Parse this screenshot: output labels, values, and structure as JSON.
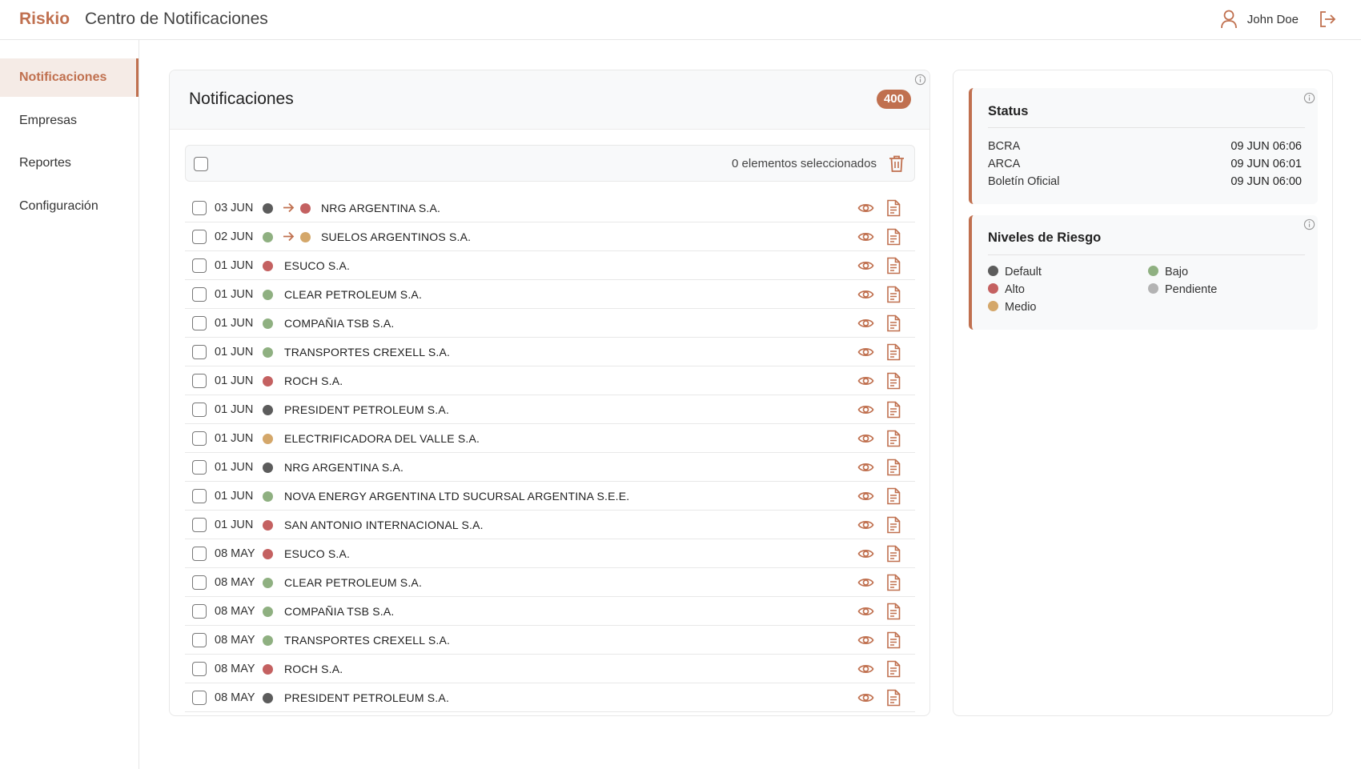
{
  "app": {
    "brand": "Riskio",
    "title": "Centro de Notificaciones",
    "user_name": "John Doe"
  },
  "sidebar": {
    "items": [
      {
        "label": "Notificaciones",
        "active": true
      },
      {
        "label": "Empresas",
        "active": false
      },
      {
        "label": "Reportes",
        "active": false
      },
      {
        "label": "Configuración",
        "active": false
      }
    ]
  },
  "notifications": {
    "title": "Notificaciones",
    "count": "400",
    "selected_text": "0 elementos seleccionados",
    "rows": [
      {
        "date": "03 JUN",
        "from": "default",
        "to": "alto",
        "company": "NRG ARGENTINA S.A."
      },
      {
        "date": "02 JUN",
        "from": "bajo",
        "to": "medio",
        "company": "SUELOS ARGENTINOS S.A."
      },
      {
        "date": "01 JUN",
        "level": "alto",
        "company": "ESUCO S.A."
      },
      {
        "date": "01 JUN",
        "level": "bajo",
        "company": "CLEAR PETROLEUM S.A."
      },
      {
        "date": "01 JUN",
        "level": "bajo",
        "company": "COMPAÑIA TSB S.A."
      },
      {
        "date": "01 JUN",
        "level": "bajo",
        "company": "TRANSPORTES CREXELL S.A."
      },
      {
        "date": "01 JUN",
        "level": "alto",
        "company": "ROCH S.A."
      },
      {
        "date": "01 JUN",
        "level": "default",
        "company": "PRESIDENT PETROLEUM S.A."
      },
      {
        "date": "01 JUN",
        "level": "medio",
        "company": "ELECTRIFICADORA DEL VALLE S.A."
      },
      {
        "date": "01 JUN",
        "level": "default",
        "company": "NRG ARGENTINA S.A."
      },
      {
        "date": "01 JUN",
        "level": "bajo",
        "company": "NOVA ENERGY ARGENTINA LTD SUCURSAL ARGENTINA S.E.E."
      },
      {
        "date": "01 JUN",
        "level": "alto",
        "company": "SAN ANTONIO INTERNACIONAL S.A."
      },
      {
        "date": "08 MAY",
        "level": "alto",
        "company": "ESUCO S.A."
      },
      {
        "date": "08 MAY",
        "level": "bajo",
        "company": "CLEAR PETROLEUM S.A."
      },
      {
        "date": "08 MAY",
        "level": "bajo",
        "company": "COMPAÑIA TSB S.A."
      },
      {
        "date": "08 MAY",
        "level": "bajo",
        "company": "TRANSPORTES CREXELL S.A."
      },
      {
        "date": "08 MAY",
        "level": "alto",
        "company": "ROCH S.A."
      },
      {
        "date": "08 MAY",
        "level": "default",
        "company": "PRESIDENT PETROLEUM S.A."
      }
    ]
  },
  "status": {
    "title": "Status",
    "items": [
      {
        "label": "BCRA",
        "value": "09 JUN 06:06"
      },
      {
        "label": "ARCA",
        "value": "09 JUN 06:01"
      },
      {
        "label": "Boletín Oficial",
        "value": "09 JUN 06:00"
      }
    ]
  },
  "risk_levels": {
    "title": "Niveles de Riesgo",
    "items": [
      {
        "key": "default",
        "label": "Default"
      },
      {
        "key": "alto",
        "label": "Alto"
      },
      {
        "key": "medio",
        "label": "Medio"
      },
      {
        "key": "bajo",
        "label": "Bajo"
      },
      {
        "key": "pendiente",
        "label": "Pendiente"
      }
    ]
  },
  "colors": {
    "accent": "#c0704f",
    "default": "#5c5c5c",
    "alto": "#c46161",
    "medio": "#d4a76a",
    "bajo": "#8fb081",
    "pendiente": "#b3b3b3"
  },
  "icons": {
    "user": "user-icon",
    "logout": "logout-icon",
    "info": "info-icon",
    "trash": "trash-icon",
    "arrow": "arrow-right-icon",
    "view": "eye-icon",
    "report": "document-icon"
  }
}
